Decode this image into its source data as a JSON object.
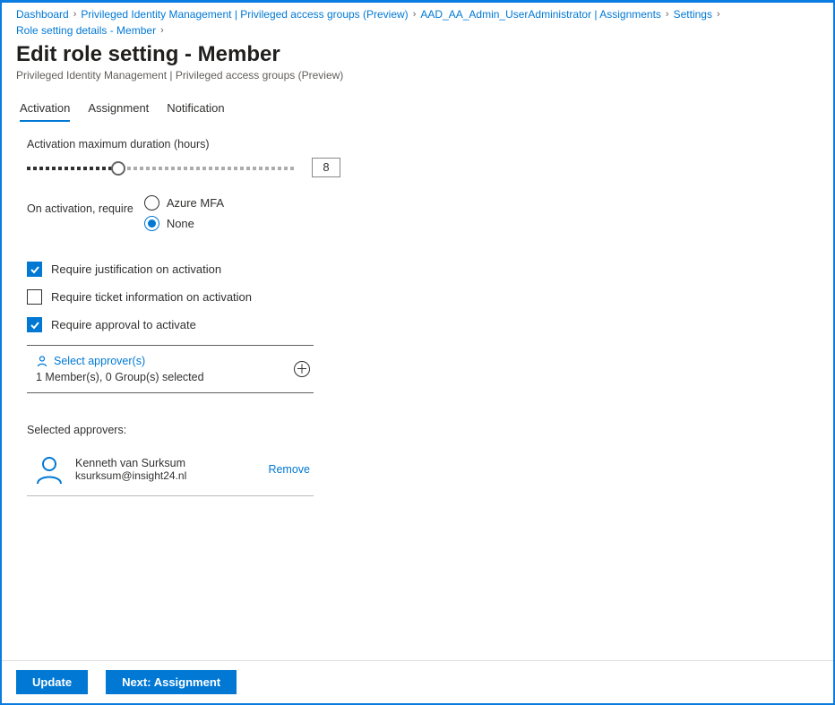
{
  "breadcrumb": {
    "items": [
      "Dashboard",
      "Privileged Identity Management | Privileged access groups (Preview)",
      "AAD_AA_Admin_UserAdministrator | Assignments",
      "Settings",
      "Role setting details - Member"
    ]
  },
  "header": {
    "title": "Edit role setting - Member",
    "subtitle": "Privileged Identity Management | Privileged access groups (Preview)"
  },
  "tabs": {
    "items": [
      "Activation",
      "Assignment",
      "Notification"
    ],
    "active_index": 0
  },
  "activation": {
    "max_duration_label": "Activation maximum duration (hours)",
    "max_duration_value": "8",
    "on_activation_label": "On activation, require",
    "options": {
      "mfa": "Azure MFA",
      "none": "None"
    },
    "selected_option": "none",
    "checks": {
      "justification": {
        "label": "Require justification on activation",
        "checked": true
      },
      "ticket": {
        "label": "Require ticket information on activation",
        "checked": false
      },
      "approval": {
        "label": "Require approval to activate",
        "checked": true
      }
    },
    "approver_panel": {
      "title": "Select approver(s)",
      "subtitle": "1 Member(s), 0 Group(s) selected"
    },
    "selected_approvers_label": "Selected approvers:",
    "selected_approvers": [
      {
        "name": "Kenneth van Surksum",
        "email": "ksurksum@insight24.nl"
      }
    ],
    "remove_label": "Remove"
  },
  "footer": {
    "update": "Update",
    "next": "Next: Assignment"
  }
}
